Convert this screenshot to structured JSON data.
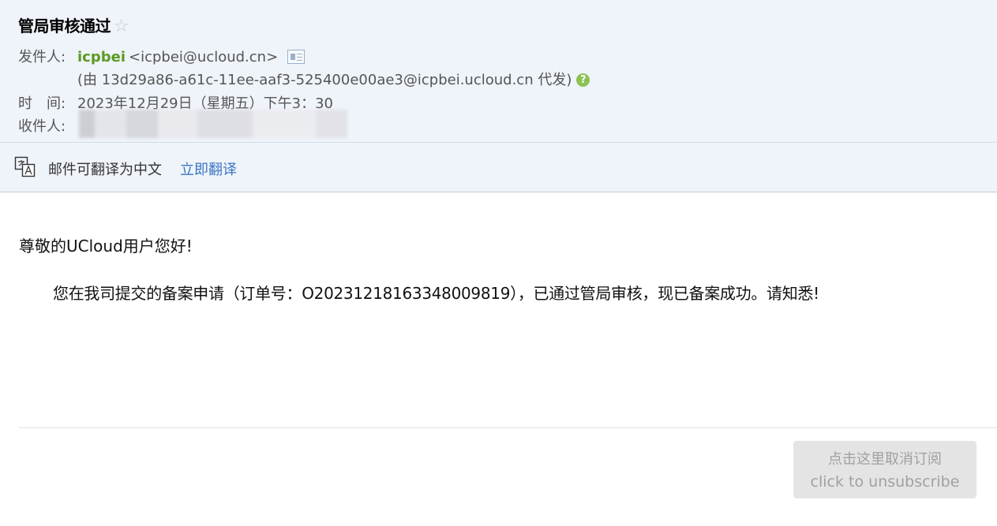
{
  "header": {
    "subject": "管局审核通过",
    "star_icon": "star-icon",
    "from_label": "发件人:",
    "sender_name": "icpbei",
    "sender_address": "<icpbei@ucloud.cn>",
    "on_behalf": "(由 13d29a86-a61c-11ee-aaf3-525400e00ae3@icpbei.ucloud.cn 代发)",
    "help_glyph": "?",
    "time_label": "时　间:",
    "time_value": "2023年12月29日（星期五）下午3：30",
    "to_label": "收件人:"
  },
  "translate": {
    "text": "邮件可翻译为中文",
    "link": "立即翻译"
  },
  "body": {
    "greeting": "尊敬的UCloud用户您好!",
    "content": "您在我司提交的备案申请（订单号：O20231218163348009819），已通过管局审核，现已备案成功。请知悉!"
  },
  "unsubscribe": {
    "line1": "点击这里取消订阅",
    "line2": "click to unsubscribe"
  },
  "colors": {
    "header_bg": "#eff3fa",
    "sender_name": "#5b9b22",
    "link": "#3a76c3",
    "help_icon": "#8cc152"
  }
}
